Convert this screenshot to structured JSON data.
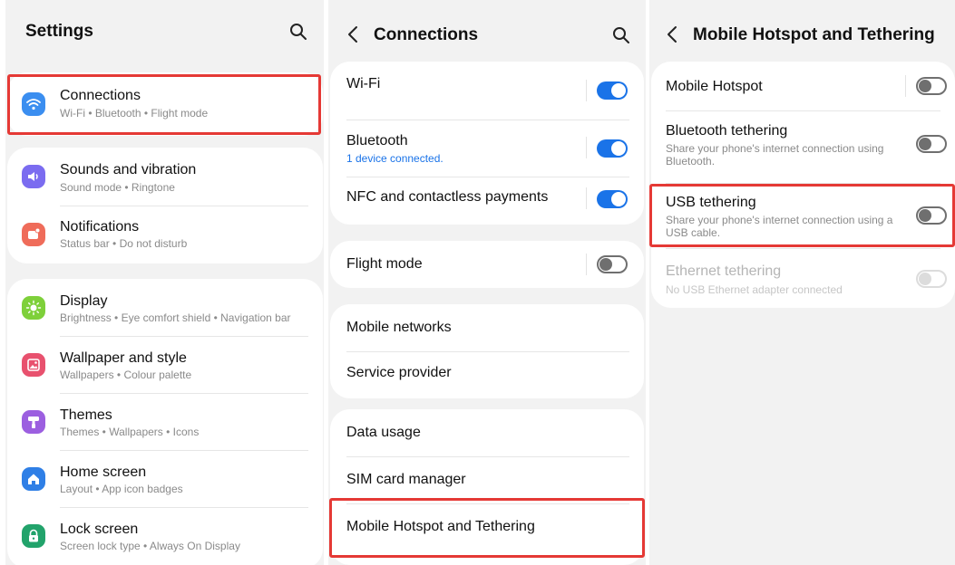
{
  "panel1": {
    "title": "Settings",
    "search_icon": "search-icon",
    "items": [
      {
        "title": "Connections",
        "subtitle": "Wi-Fi  •  Bluetooth  •  Flight mode",
        "icon": "wifi-icon",
        "color": "#3b8ef0"
      },
      {
        "title": "Sounds and vibration",
        "subtitle": "Sound mode  •  Ringtone",
        "icon": "speaker-icon",
        "color": "#7b6cf0"
      },
      {
        "title": "Notifications",
        "subtitle": "Status bar  •  Do not disturb",
        "icon": "notification-icon",
        "color": "#ef6c5a"
      },
      {
        "title": "Display",
        "subtitle": "Brightness  •  Eye comfort shield  •  Navigation bar",
        "icon": "sun-icon",
        "color": "#7ed03a"
      },
      {
        "title": "Wallpaper and style",
        "subtitle": "Wallpapers  •  Colour palette",
        "icon": "wallpaper-icon",
        "color": "#e8516e"
      },
      {
        "title": "Themes",
        "subtitle": "Themes  •  Wallpapers  •  Icons",
        "icon": "brush-icon",
        "color": "#9c5fe0"
      },
      {
        "title": "Home screen",
        "subtitle": "Layout  •  App icon badges",
        "icon": "home-icon",
        "color": "#2f7fe6"
      },
      {
        "title": "Lock screen",
        "subtitle": "Screen lock type  •  Always On Display",
        "icon": "lock-icon",
        "color": "#22a36b"
      }
    ]
  },
  "panel2": {
    "title": "Connections",
    "items": [
      {
        "title": "Wi-Fi",
        "toggle": "on"
      },
      {
        "title": "Bluetooth",
        "subtitle": "1 device connected.",
        "toggle": "on"
      },
      {
        "title": "NFC and contactless payments",
        "toggle": "on"
      },
      {
        "title": "Flight mode",
        "toggle": "off"
      },
      {
        "title": "Mobile networks"
      },
      {
        "title": "Service provider"
      },
      {
        "title": "Data usage"
      },
      {
        "title": "SIM card manager"
      },
      {
        "title": "Mobile Hotspot and Tethering"
      }
    ]
  },
  "panel3": {
    "title": "Mobile Hotspot and Tethering",
    "items": [
      {
        "title": "Mobile Hotspot",
        "toggle": "off"
      },
      {
        "title": "Bluetooth tethering",
        "subtitle": "Share your phone's internet connection using Bluetooth.",
        "toggle": "off"
      },
      {
        "title": "USB tethering",
        "subtitle": "Share your phone's internet connection using a USB cable.",
        "toggle": "off"
      },
      {
        "title": "Ethernet tethering",
        "subtitle": "No USB Ethernet adapter connected",
        "toggle": "disabled"
      }
    ]
  },
  "colors": {
    "accent": "#1a73e8",
    "highlight": "#e53935",
    "background": "#f2f2f2",
    "card": "#ffffff"
  }
}
